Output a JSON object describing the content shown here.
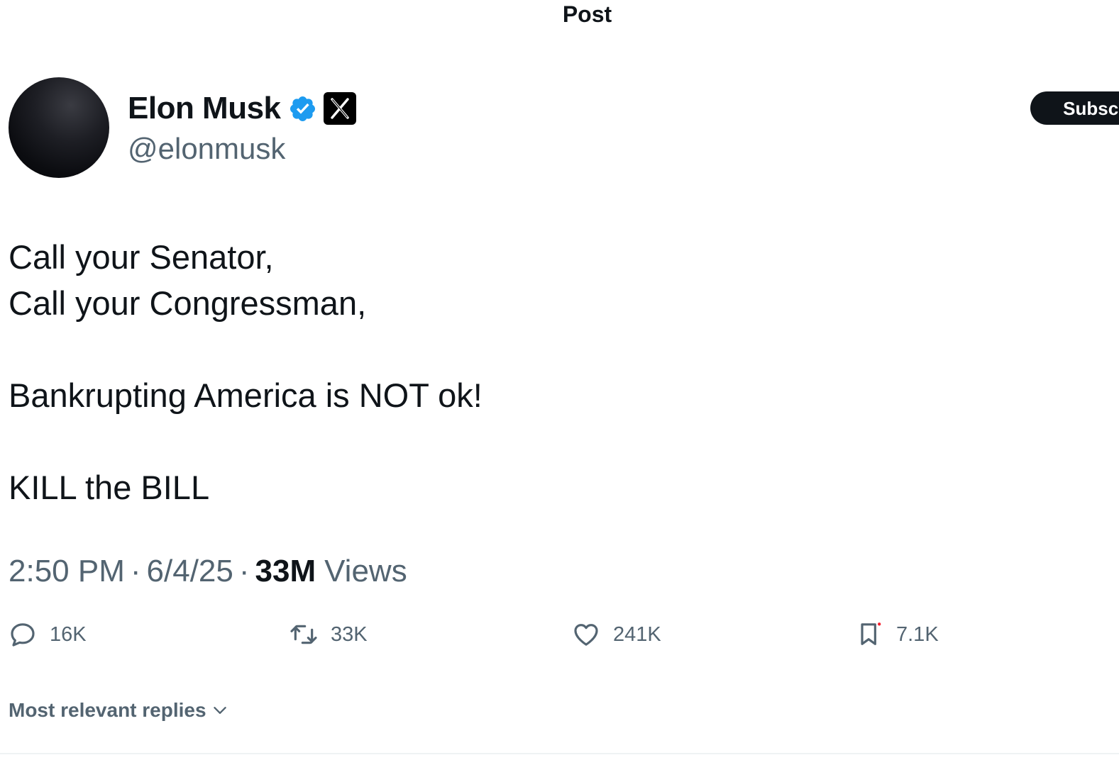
{
  "header": {
    "title": "Post"
  },
  "author": {
    "display_name": "Elon Musk",
    "handle": "@elonmusk",
    "verified_icon": "verified-badge-icon",
    "affiliate_icon": "x-logo-icon"
  },
  "subscribe": {
    "label": "Subscribe"
  },
  "post": {
    "lines": [
      "Call your Senator,",
      "Call your Congressman,",
      "Bankrupting America is NOT ok!",
      "KILL the BILL"
    ],
    "time": "2:50 PM",
    "date": "6/4/25",
    "separator": "·",
    "views_count": "33M",
    "views_label": "Views"
  },
  "actions": {
    "replies": "16K",
    "reposts": "33K",
    "likes": "241K",
    "bookmarks": "7.1K"
  },
  "replies_sort": {
    "label": "Most relevant replies"
  },
  "colors": {
    "primary_text": "#0f1419",
    "secondary_text": "#536471",
    "verified_blue": "#1d9bf0",
    "subscribe_bg": "#0f1419",
    "notification_dot": "#f4212e"
  }
}
